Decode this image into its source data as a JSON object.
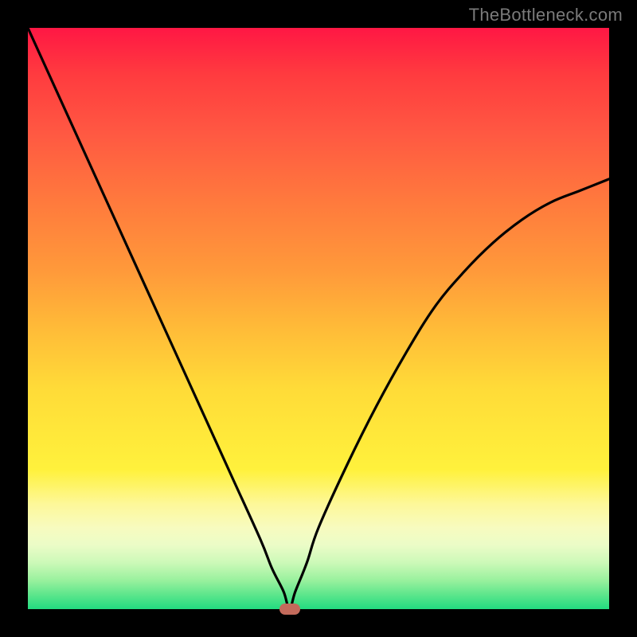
{
  "watermark": "TheBottleneck.com",
  "chart_data": {
    "type": "line",
    "title": "",
    "xlabel": "",
    "ylabel": "",
    "xlim": [
      0,
      100
    ],
    "ylim": [
      0,
      100
    ],
    "series": [
      {
        "name": "bottleneck-curve",
        "x": [
          0,
          5,
          10,
          15,
          20,
          25,
          30,
          35,
          40,
          42,
          44,
          45,
          46,
          48,
          50,
          55,
          60,
          65,
          70,
          75,
          80,
          85,
          90,
          95,
          100
        ],
        "y": [
          100,
          89,
          78,
          67,
          56,
          45,
          34,
          23,
          12,
          7,
          3,
          0,
          3,
          8,
          14,
          25,
          35,
          44,
          52,
          58,
          63,
          67,
          70,
          72,
          74
        ]
      }
    ],
    "marker": {
      "x": 45,
      "y": 0,
      "color": "#c36a5b"
    },
    "gradient_stops": [
      {
        "pos": 0,
        "color": "#ff1744"
      },
      {
        "pos": 50,
        "color": "#ffbc38"
      },
      {
        "pos": 80,
        "color": "#fff13c"
      },
      {
        "pos": 100,
        "color": "#22db80"
      }
    ]
  }
}
